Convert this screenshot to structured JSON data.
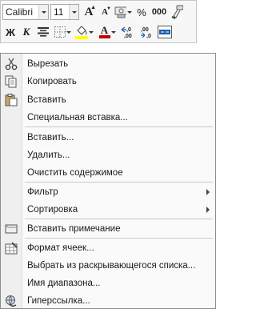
{
  "mini_toolbar": {
    "font_name": "Calibri",
    "font_size": "11",
    "grow_font": "A",
    "shrink_font": "A",
    "percent": "%",
    "thousands": "000",
    "bold": "Ж",
    "italic": "К",
    "font_color_letter": "A",
    "increase_decimal": "←,0\n,00",
    "decrease_decimal": ",00\n→,0"
  },
  "menu": {
    "items": [
      {
        "label": "Вырезать",
        "icon": "scissors-icon"
      },
      {
        "label": "Копировать",
        "icon": "copy-icon"
      },
      {
        "label": "Вставить",
        "icon": "paste-icon"
      },
      {
        "label": "Специальная вставка...",
        "icon": ""
      },
      {
        "label": "Вставить...",
        "icon": ""
      },
      {
        "label": "Удалить...",
        "icon": ""
      },
      {
        "label": "Очистить содержимое",
        "icon": ""
      },
      {
        "label": "Фильтр",
        "icon": "",
        "submenu": true
      },
      {
        "label": "Сортировка",
        "icon": "",
        "submenu": true
      },
      {
        "label": "Вставить примечание",
        "icon": "comment-icon"
      },
      {
        "label": "Формат ячеек...",
        "icon": "format-cells-icon"
      },
      {
        "label": "Выбрать из раскрывающегося списка...",
        "icon": ""
      },
      {
        "label": "Имя диапазона...",
        "icon": ""
      },
      {
        "label": "Гиперссылка...",
        "icon": "hyperlink-icon"
      }
    ]
  },
  "colors": {
    "font_color_bar": "#c00000",
    "fill_color_bar": "#ffff00"
  }
}
